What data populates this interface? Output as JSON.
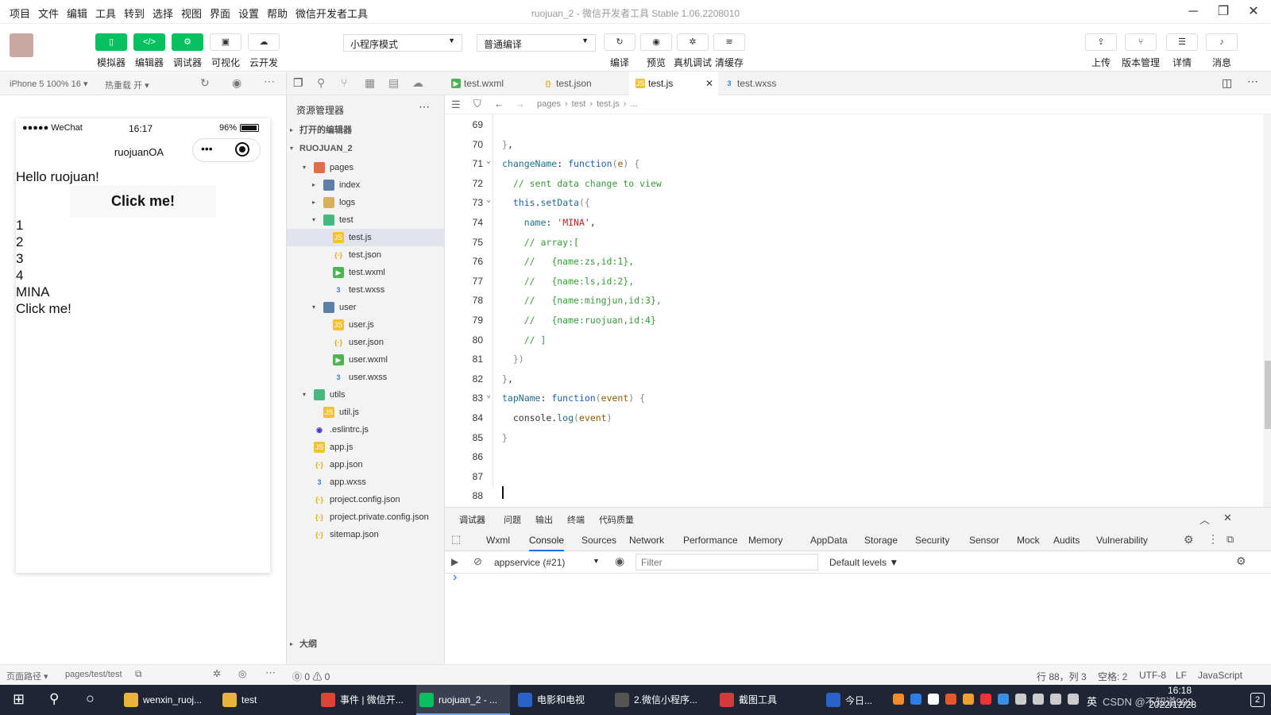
{
  "menu": [
    "项目",
    "文件",
    "编辑",
    "工具",
    "转到",
    "选择",
    "视图",
    "界面",
    "设置",
    "帮助",
    "微信开发者工具"
  ],
  "window_title": "ruojuan_2 - 微信开发者工具 Stable 1.06.2208010",
  "toolbar": {
    "left_buttons": [
      {
        "label": "模拟器",
        "icon": "phone-icon"
      },
      {
        "label": "编辑器",
        "icon": "code-icon"
      },
      {
        "label": "调试器",
        "icon": "debug-icon"
      },
      {
        "label": "可视化",
        "icon": "layout-icon"
      },
      {
        "label": "云开发",
        "icon": "cloud-icon"
      }
    ],
    "mode_select": "小程序模式",
    "compile_select": "普通编译",
    "mid_buttons": [
      {
        "label": "编译",
        "icon": "refresh-icon"
      },
      {
        "label": "预览",
        "icon": "eye-icon"
      },
      {
        "label": "真机调试",
        "icon": "bug-icon"
      },
      {
        "label": "清缓存",
        "icon": "layers-icon"
      }
    ],
    "right_buttons": [
      {
        "label": "上传",
        "icon": "upload-icon"
      },
      {
        "label": "版本管理",
        "icon": "branch-icon"
      },
      {
        "label": "详情",
        "icon": "menu-icon"
      },
      {
        "label": "消息",
        "icon": "bell-icon"
      }
    ]
  },
  "simulator": {
    "device": "iPhone 5 100% 16",
    "hot_reload": "热重载 开",
    "status_carrier": "●●●●● WeChat",
    "status_time": "16:17",
    "status_battery": "96%",
    "nav_title": "ruojuanOA",
    "content": {
      "hello": "Hello ruojuan!",
      "button": "Click me!",
      "list": [
        "1",
        "2",
        "3",
        "4"
      ],
      "name": "MINA",
      "footer": "Click me!"
    },
    "footer_path_label": "页面路径",
    "footer_path": "pages/test/test"
  },
  "explorer": {
    "title": "资源管理器",
    "open_editors": "打开的编辑器",
    "project": "RUOJUAN_2",
    "outline": "大纲",
    "tree": [
      {
        "name": "pages",
        "type": "folderr",
        "depth": 1,
        "arrow": "▾"
      },
      {
        "name": "index",
        "type": "folderb",
        "depth": 2,
        "arrow": "▸"
      },
      {
        "name": "logs",
        "type": "folder",
        "depth": 2,
        "arrow": "▸"
      },
      {
        "name": "test",
        "type": "folderg",
        "depth": 2,
        "arrow": "▾"
      },
      {
        "name": "test.js",
        "type": "js",
        "depth": 3,
        "arrow": "",
        "selected": true
      },
      {
        "name": "test.json",
        "type": "json",
        "depth": 3,
        "arrow": ""
      },
      {
        "name": "test.wxml",
        "type": "wxml",
        "depth": 3,
        "arrow": ""
      },
      {
        "name": "test.wxss",
        "type": "wxss",
        "depth": 3,
        "arrow": ""
      },
      {
        "name": "user",
        "type": "folderb",
        "depth": 2,
        "arrow": "▾"
      },
      {
        "name": "user.js",
        "type": "js",
        "depth": 3,
        "arrow": ""
      },
      {
        "name": "user.json",
        "type": "json",
        "depth": 3,
        "arrow": ""
      },
      {
        "name": "user.wxml",
        "type": "wxml",
        "depth": 3,
        "arrow": ""
      },
      {
        "name": "user.wxss",
        "type": "wxss",
        "depth": 3,
        "arrow": ""
      },
      {
        "name": "utils",
        "type": "folderg",
        "depth": 1,
        "arrow": "▾"
      },
      {
        "name": "util.js",
        "type": "js",
        "depth": 2,
        "arrow": ""
      },
      {
        "name": ".eslintrc.js",
        "type": "eslint",
        "depth": 1,
        "arrow": ""
      },
      {
        "name": "app.js",
        "type": "js",
        "depth": 1,
        "arrow": ""
      },
      {
        "name": "app.json",
        "type": "json",
        "depth": 1,
        "arrow": ""
      },
      {
        "name": "app.wxss",
        "type": "wxss",
        "depth": 1,
        "arrow": ""
      },
      {
        "name": "project.config.json",
        "type": "json",
        "depth": 1,
        "arrow": ""
      },
      {
        "name": "project.private.config.json",
        "type": "json",
        "depth": 1,
        "arrow": ""
      },
      {
        "name": "sitemap.json",
        "type": "json",
        "depth": 1,
        "arrow": ""
      }
    ]
  },
  "editor": {
    "tabs": [
      {
        "name": "test.wxml",
        "type": "wxml",
        "active": false
      },
      {
        "name": "test.json",
        "type": "json",
        "active": false
      },
      {
        "name": "test.js",
        "type": "js",
        "active": true
      },
      {
        "name": "test.wxss",
        "type": "wxss",
        "active": false
      }
    ],
    "breadcrumb": [
      "pages",
      "test",
      "test.js",
      "..."
    ],
    "lines": [
      {
        "n": "69",
        "fold": false,
        "html": ""
      },
      {
        "n": "70",
        "fold": false,
        "html": "<span class=\"b\">}</span>,"
      },
      {
        "n": "71",
        "fold": true,
        "html": "<span class=\"p\">changeName</span>: <span class=\"k\">function</span><span class=\"b\">(</span><span class=\"v\">e</span><span class=\"b\">) {</span>"
      },
      {
        "n": "72",
        "fold": false,
        "html": "  <span class=\"c\">// sent data change to view</span>"
      },
      {
        "n": "73",
        "fold": true,
        "html": "  <span class=\"k\">this</span>.<span class=\"p\">setData</span><span class=\"b\">({</span>"
      },
      {
        "n": "74",
        "fold": false,
        "html": "    <span class=\"p\">name</span>: <span class=\"s\">'MINA'</span>,"
      },
      {
        "n": "75",
        "fold": false,
        "html": "    <span class=\"c\">// array:[</span>"
      },
      {
        "n": "76",
        "fold": false,
        "html": "    <span class=\"c\">//   {name:zs,id:1},</span>"
      },
      {
        "n": "77",
        "fold": false,
        "html": "    <span class=\"c\">//   {name:ls,id:2},</span>"
      },
      {
        "n": "78",
        "fold": false,
        "html": "    <span class=\"c\">//   {name:mingjun,id:3},</span>"
      },
      {
        "n": "79",
        "fold": false,
        "html": "    <span class=\"c\">//   {name:ruojuan,id:4}</span>"
      },
      {
        "n": "80",
        "fold": false,
        "html": "    <span class=\"c\">// ]</span>"
      },
      {
        "n": "81",
        "fold": false,
        "html": "  <span class=\"b\">})</span>"
      },
      {
        "n": "82",
        "fold": false,
        "html": "<span class=\"b\">}</span>,"
      },
      {
        "n": "83",
        "fold": true,
        "html": "<span class=\"p\">tapName</span>: <span class=\"k\">function</span><span class=\"b\">(</span><span class=\"v\">event</span><span class=\"b\">) {</span>"
      },
      {
        "n": "84",
        "fold": false,
        "html": "  console.<span class=\"p\">log</span><span class=\"b\">(</span><span class=\"v\">event</span><span class=\"b\">)</span>"
      },
      {
        "n": "85",
        "fold": false,
        "html": "<span class=\"b\">}</span>"
      },
      {
        "n": "86",
        "fold": false,
        "html": ""
      },
      {
        "n": "87",
        "fold": false,
        "html": ""
      },
      {
        "n": "88",
        "fold": false,
        "html": ""
      }
    ]
  },
  "devtools": {
    "top_tabs": [
      "调试器",
      "问题",
      "输出",
      "终端",
      "代码质量"
    ],
    "tabs": [
      "Wxml",
      "Console",
      "Sources",
      "Network",
      "Performance",
      "Memory",
      "AppData",
      "Storage",
      "Security",
      "Sensor",
      "Mock",
      "Audits",
      "Vulnerability"
    ],
    "active_tab": "Console",
    "context": "appservice (#21)",
    "filter_placeholder": "Filter",
    "levels": "Default levels ▼",
    "prompt": "›"
  },
  "statusbar": {
    "errors": "⓪ 0 ⚠ 0",
    "position": "行 88，列 3",
    "spaces": "空格: 2",
    "encoding": "UTF-8",
    "eol": "LF",
    "language": "JavaScript"
  },
  "taskbar": {
    "items": [
      {
        "label": "wenxin_ruoj...",
        "color": "#e8b53a",
        "active": false
      },
      {
        "label": "test",
        "color": "#e8b53a",
        "active": false
      },
      {
        "label": "事件 | 微信开...",
        "color": "#db4437",
        "active": false
      },
      {
        "label": "ruojuan_2 - ...",
        "color": "#07c160",
        "active": true
      },
      {
        "label": "电影和电视",
        "color": "#2b62c8",
        "active": false
      },
      {
        "label": "2.微信小程序...",
        "color": "#555",
        "active": false
      },
      {
        "label": "截图工具",
        "color": "#d23b3b",
        "active": false
      }
    ],
    "news": "今日...",
    "ime": "英",
    "watermark": "CSDN @不知道999",
    "time": "16:18",
    "date": "2022/12/28",
    "notif": "2"
  }
}
